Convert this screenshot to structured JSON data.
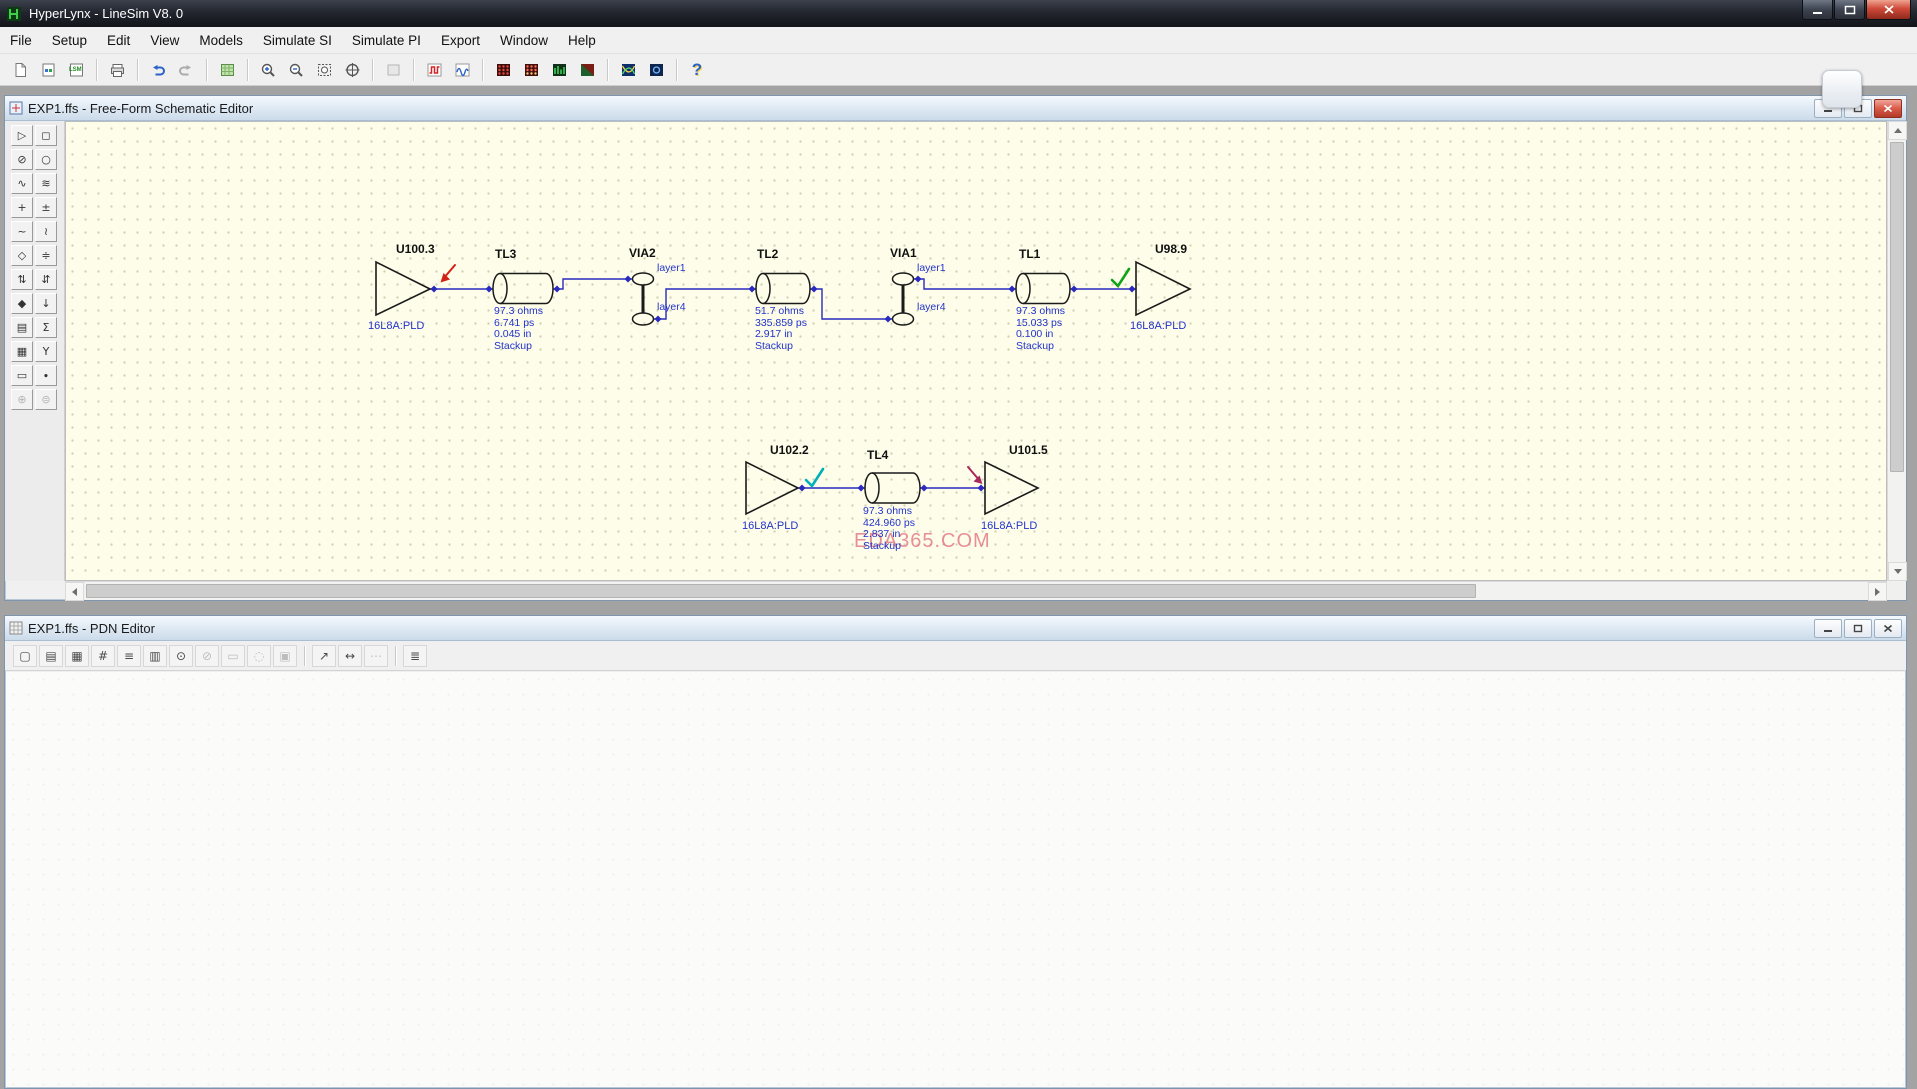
{
  "window": {
    "title": "HyperLynx - LineSim V8. 0"
  },
  "menu": {
    "items": [
      "File",
      "Setup",
      "Edit",
      "View",
      "Models",
      "Simulate SI",
      "Simulate PI",
      "Export",
      "Window",
      "Help"
    ]
  },
  "main_toolbar": {
    "save_label": "LSM",
    "help_glyph": "?"
  },
  "schematic_editor": {
    "title": "EXP1.ffs - Free-Form Schematic Editor",
    "watermark": "EDA365.COM",
    "tools": [
      {
        "name": "wire-tool",
        "glyph": "▷"
      },
      {
        "name": "select-tool",
        "glyph": "◻"
      },
      {
        "name": "disconnect-tool",
        "glyph": "⊘"
      },
      {
        "name": "pin-tool",
        "glyph": "○"
      },
      {
        "name": "tline-tool",
        "glyph": "∿"
      },
      {
        "name": "coupled-line-tool",
        "glyph": "≋"
      },
      {
        "name": "add-node-tool",
        "glyph": "+"
      },
      {
        "name": "cross-tool",
        "glyph": "±"
      },
      {
        "name": "ac-source-tool",
        "glyph": "~"
      },
      {
        "name": "squiggle-tool",
        "glyph": "≀"
      },
      {
        "name": "via-tool",
        "glyph": "◇"
      },
      {
        "name": "stackup-tool",
        "glyph": "≑"
      },
      {
        "name": "swap-tool",
        "glyph": "⇅"
      },
      {
        "name": "transfer-tool",
        "glyph": "⇵"
      },
      {
        "name": "diamond-tool",
        "glyph": "◆"
      },
      {
        "name": "down-tool",
        "glyph": "↓"
      },
      {
        "name": "ic-tool",
        "glyph": "▤"
      },
      {
        "name": "sum-tool",
        "glyph": "Σ"
      },
      {
        "name": "grid-tool",
        "glyph": "▦"
      },
      {
        "name": "probe-tool",
        "glyph": "Y"
      },
      {
        "name": "resistor-tool",
        "glyph": "▭"
      },
      {
        "name": "dot-tool",
        "glyph": "∙"
      },
      {
        "name": "power-tool",
        "glyph": "⊕"
      },
      {
        "name": "ground-tool",
        "glyph": "⊜"
      }
    ],
    "buffers": [
      {
        "ref": "U100.3",
        "model": "16L8A:PLD"
      },
      {
        "ref": "U98.9",
        "model": "16L8A:PLD"
      },
      {
        "ref": "U102.2",
        "model": "16L8A:PLD"
      },
      {
        "ref": "U101.5",
        "model": "16L8A:PLD"
      }
    ],
    "tlines": [
      {
        "ref": "TL3",
        "line1": "97.3 ohms",
        "line2": "6.741 ps",
        "line3": "0.045 in",
        "line4": "Stackup"
      },
      {
        "ref": "TL2",
        "line1": "51.7 ohms",
        "line2": "335.859 ps",
        "line3": "2.917 in",
        "line4": "Stackup"
      },
      {
        "ref": "TL1",
        "line1": "97.3 ohms",
        "line2": "15.033 ps",
        "line3": "0.100 in",
        "line4": "Stackup"
      },
      {
        "ref": "TL4",
        "line1": "97.3 ohms",
        "line2": "424.960 ps",
        "line3": "2.837 in",
        "line4": "Stackup"
      }
    ],
    "vias": [
      {
        "ref": "VIA2",
        "top": "layer1",
        "bottom": "layer4"
      },
      {
        "ref": "VIA1",
        "top": "layer1",
        "bottom": "layer4"
      }
    ]
  },
  "pdn_editor": {
    "title": "EXP1.ffs - PDN Editor",
    "tools": [
      {
        "name": "area-select-tool",
        "glyph": "▢"
      },
      {
        "name": "page-tool",
        "glyph": "▤"
      },
      {
        "name": "grid-tool",
        "glyph": "▦"
      },
      {
        "name": "plane-tool",
        "glyph": "#"
      },
      {
        "name": "plane2-tool",
        "glyph": "≡"
      },
      {
        "name": "bars-tool",
        "glyph": "▥"
      },
      {
        "name": "probe-a-tool",
        "glyph": "⊙"
      },
      {
        "name": "probe-b-tool",
        "glyph": "⊘"
      },
      {
        "name": "rect-tool",
        "glyph": "▭"
      },
      {
        "name": "circle-tool",
        "glyph": "◌"
      },
      {
        "name": "layer-tool",
        "glyph": "▣"
      },
      {
        "name": "line-probe-tool",
        "glyph": "↗"
      },
      {
        "name": "measure-tool",
        "glyph": "↔"
      },
      {
        "name": "more-tool",
        "glyph": "⋯"
      },
      {
        "name": "print-tool",
        "glyph": "≣"
      }
    ]
  },
  "colors": {
    "canvas": "#fdfde9",
    "wire": "#2a2ac0",
    "label_blue": "#2233cc",
    "check_green": "#0fa317",
    "check_cyan": "#00b0b8",
    "check_magenta": "#a8285e",
    "cursor_red": "#d42015",
    "close_red": "#cf4a38"
  }
}
